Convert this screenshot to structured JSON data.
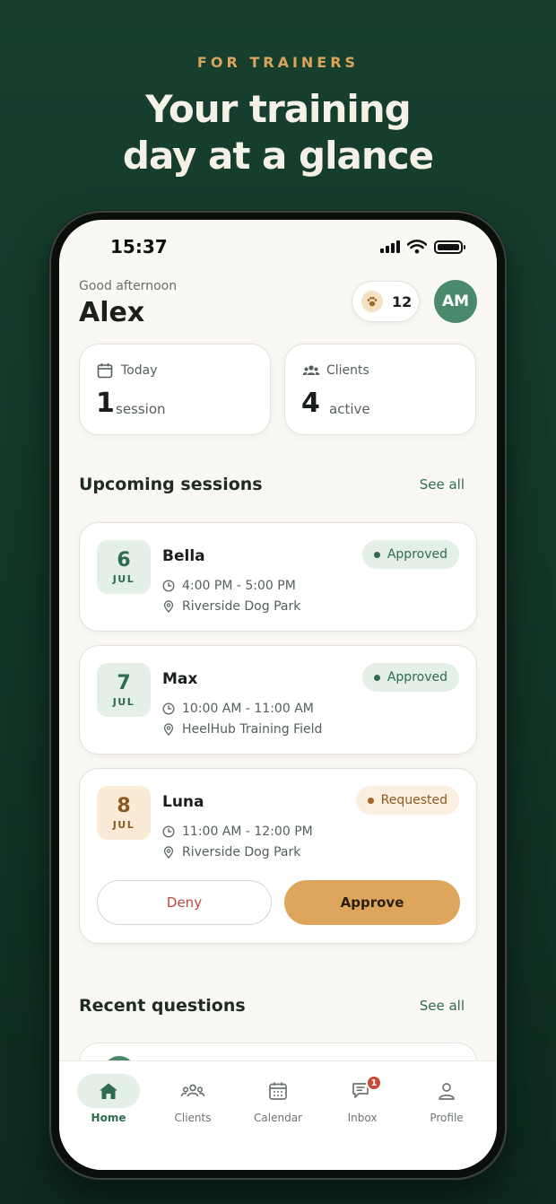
{
  "promo": {
    "kicker": "FOR TRAINERS",
    "headline_line1": "Your training",
    "headline_line2": "day at a glance"
  },
  "status_bar": {
    "time": "15:37"
  },
  "header": {
    "greeting": "Good afternoon",
    "name": "Alex",
    "paw_points": "12",
    "avatar_initials": "AM"
  },
  "stats": [
    {
      "label": "Today",
      "value": "1",
      "unit": "session",
      "icon": "calendar-icon"
    },
    {
      "label": "Clients",
      "value": "4",
      "unit": "active",
      "icon": "people-icon"
    }
  ],
  "upcoming": {
    "title": "Upcoming sessions",
    "see_all": "See all",
    "sessions": [
      {
        "day": "6",
        "month": "JUL",
        "dog": "Bella",
        "time": "4:00 PM - 5:00 PM",
        "location": "Riverside Dog Park",
        "status": "Approved"
      },
      {
        "day": "7",
        "month": "JUL",
        "dog": "Max",
        "time": "10:00 AM - 11:00 AM",
        "location": "HeelHub Training Field",
        "status": "Approved"
      },
      {
        "day": "8",
        "month": "JUL",
        "dog": "Luna",
        "time": "11:00 AM - 12:00 PM",
        "location": "Riverside Dog Park",
        "status": "Requested",
        "deny_label": "Deny",
        "approve_label": "Approve"
      }
    ]
  },
  "questions": {
    "title": "Recent questions",
    "see_all": "See all"
  },
  "tabs": [
    {
      "label": "Home",
      "icon": "home-icon",
      "active": true
    },
    {
      "label": "Clients",
      "icon": "people-icon"
    },
    {
      "label": "Calendar",
      "icon": "calendar-icon"
    },
    {
      "label": "Inbox",
      "icon": "chat-icon",
      "badge": "1"
    },
    {
      "label": "Profile",
      "icon": "user-icon"
    }
  ],
  "colors": {
    "brand_green": "#2f6b4f",
    "approve_amber": "#dea65c",
    "deny_red": "#c0473a",
    "background": "#faf8f4"
  }
}
